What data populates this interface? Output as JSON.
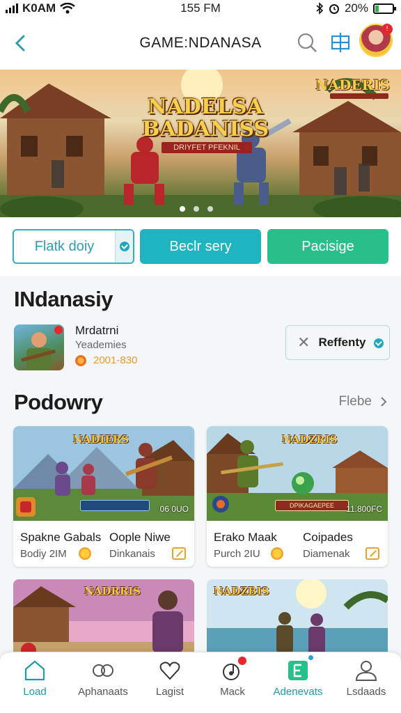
{
  "status_bar": {
    "carrier": "K0AM",
    "time": "155 FM",
    "battery": "20%",
    "battery_level": 0.2
  },
  "header": {
    "title": "GAME:NDANASA"
  },
  "hero": {
    "title_line1": "NADELSA",
    "title_line2": "BADANISS",
    "subtitle": "DRIYFET PFEKNIL",
    "corner_logo": "NADERIS",
    "slide_count": 3,
    "active_slide": 0
  },
  "actions": [
    {
      "label": "Flatk doiy"
    },
    {
      "label": "Beclr sery"
    },
    {
      "label": "Pacisige"
    }
  ],
  "featured": {
    "heading": "INdanasiy",
    "game": {
      "name": "Mrdatrni",
      "genre": "Yeademies",
      "meta": "2001-830"
    },
    "refresh_label": "Reffenty"
  },
  "popular": {
    "heading": "Podowry",
    "see_more": "Flebe",
    "cards": [
      {
        "logo": "NADIERS",
        "tag": "06 0UO",
        "t1": "Spakne Gabals",
        "t2": "Oople Niwe",
        "s1": "Bodiy 2IM",
        "s2": "Dinkanais"
      },
      {
        "logo": "NADZRIS",
        "tag": "11.800FC",
        "bar": "DPIKAGAEPEE",
        "t1": "Erako Maak",
        "t2": "Coipades",
        "s1": "Purch 2IU",
        "s2": "Diamenak"
      }
    ],
    "peek_cards": [
      {
        "logo": "NADRRIS"
      },
      {
        "logo": "NADZBIS"
      }
    ]
  },
  "bottom_nav": [
    {
      "label": "Load",
      "icon": "home-icon",
      "active": true
    },
    {
      "label": "Aphanaats",
      "icon": "controller-icon",
      "active": false
    },
    {
      "label": "Lagist",
      "icon": "heart-icon",
      "active": false
    },
    {
      "label": "Mack",
      "icon": "notes-icon",
      "active": false
    },
    {
      "label": "Adenevats",
      "icon": "app-icon",
      "active": false
    },
    {
      "label": "Lsdaads",
      "icon": "profile-icon",
      "active": false
    }
  ],
  "colors": {
    "accent_teal": "#1fb4c0",
    "accent_green": "#27c08a",
    "badge_red": "#e8262d"
  }
}
